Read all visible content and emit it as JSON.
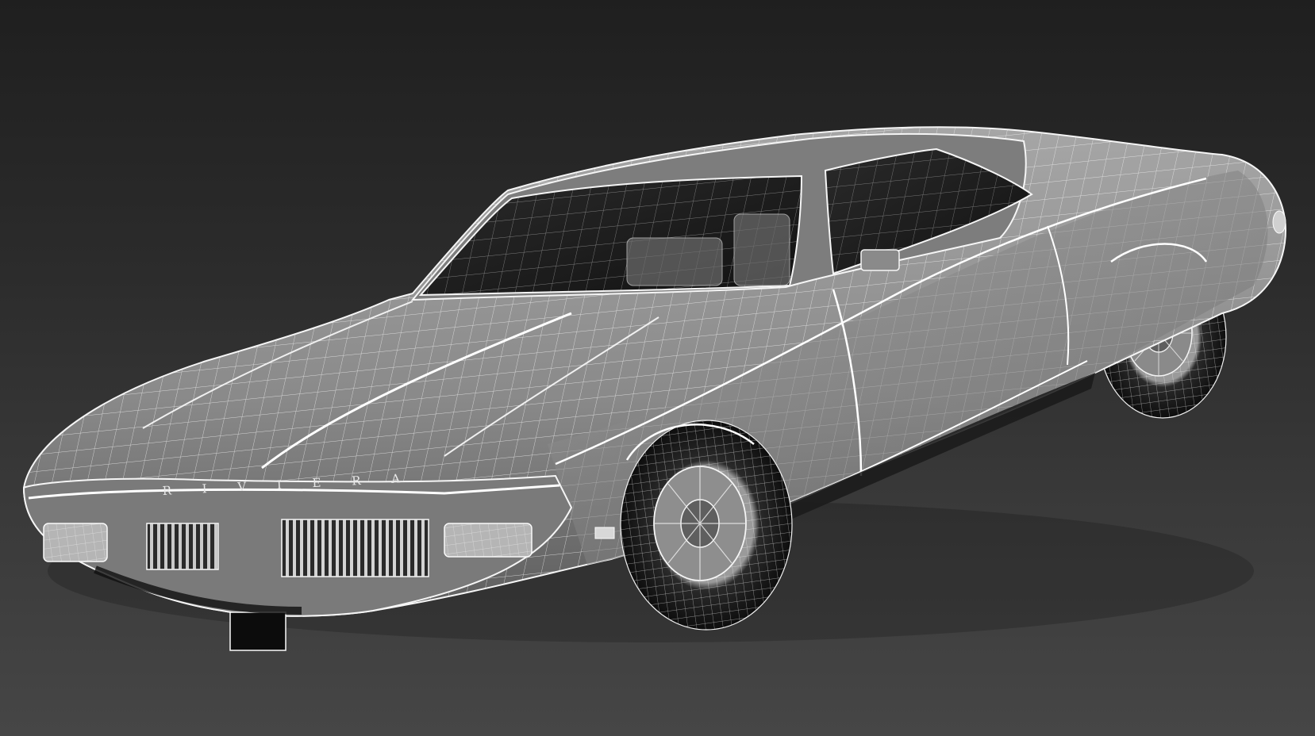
{
  "scene": {
    "subject": "car-wireframe",
    "emblem_text": "R I V I E R A"
  },
  "colors": {
    "background_top": "#1f1f1f",
    "background_bottom": "#464646",
    "body_fill": "#8f8f8f",
    "body_shade": "#6e6e6e",
    "wire": "#f2f2f2",
    "glass": "#1a1a1a",
    "tire": "#101010"
  }
}
